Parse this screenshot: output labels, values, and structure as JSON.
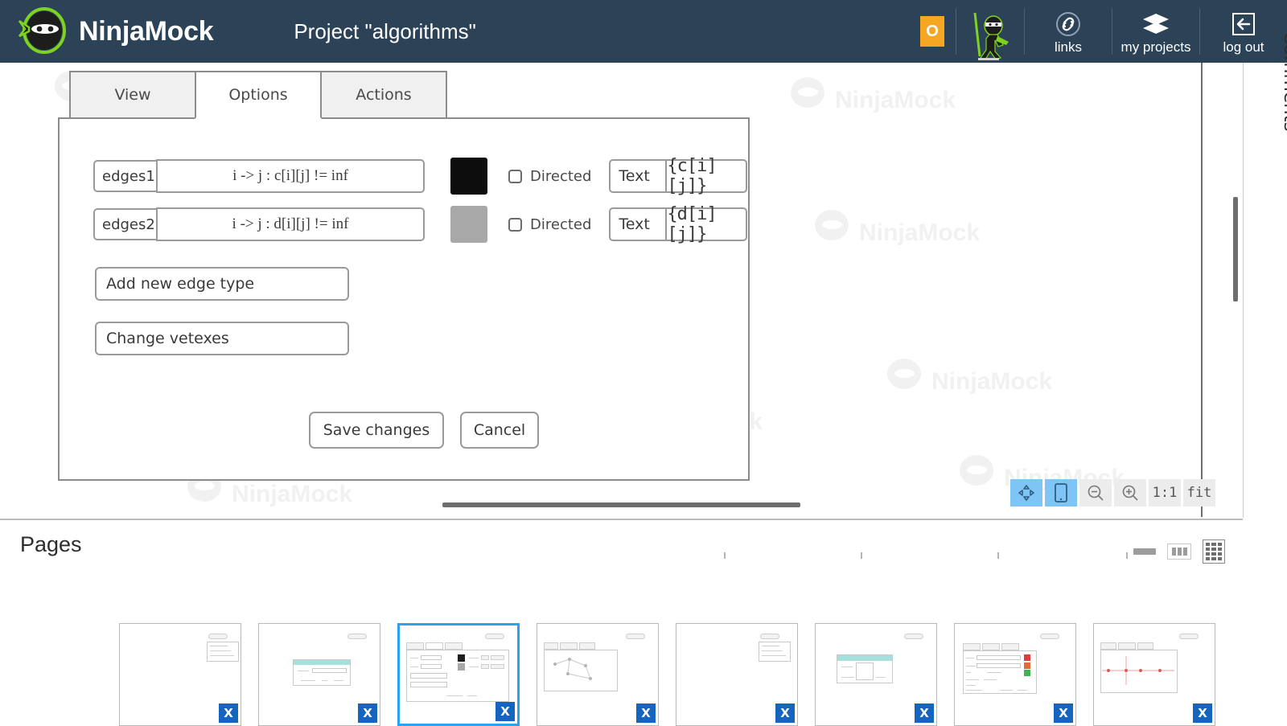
{
  "header": {
    "brand": "NinjaMock",
    "project_title": "Project \"algorithms\"",
    "badge_letter": "O",
    "items": [
      {
        "label": "links",
        "icon": "link-icon"
      },
      {
        "label": "my projects",
        "icon": "layers-icon"
      },
      {
        "label": "log out",
        "icon": "logout-arrow-icon"
      }
    ]
  },
  "canvas": {
    "tabs": [
      {
        "label": "View",
        "active": false
      },
      {
        "label": "Options",
        "active": true
      },
      {
        "label": "Actions",
        "active": false
      }
    ],
    "edge_rows": [
      {
        "name": "edges1",
        "expression": "i -> j : c[i][j] != inf",
        "color": "#0d0d0d",
        "directed_label": "Directed",
        "directed_checked": false,
        "text_type": "Text",
        "text_value": "{c[i][j]}"
      },
      {
        "name": "edges2",
        "expression": "i -> j : d[i][j] != inf",
        "color": "#a8a8a8",
        "directed_label": "Directed",
        "directed_checked": false,
        "text_type": "Text",
        "text_value": "{d[i][j]}"
      }
    ],
    "add_edge_type_label": "Add new edge type",
    "change_vertexes_label": "Change vetexes",
    "save_label": "Save changes",
    "cancel_label": "Cancel",
    "watermark_text": "NinjaMock"
  },
  "zoom_toolbar": {
    "buttons": [
      {
        "id": "pan",
        "glyph": "✥",
        "icon": "move-arrows-icon",
        "active": true
      },
      {
        "id": "device",
        "glyph": "▯",
        "icon": "device-frame-icon",
        "active": true
      },
      {
        "id": "zoom-out",
        "glyph": "⊖",
        "icon": "zoom-out-icon",
        "active": false
      },
      {
        "id": "zoom-in",
        "glyph": "⊕",
        "icon": "zoom-in-icon",
        "active": false
      },
      {
        "id": "actual-size",
        "glyph": "1:1",
        "icon": "one-to-one-icon",
        "active": false
      },
      {
        "id": "fit",
        "glyph": "fit",
        "icon": "fit-icon",
        "active": false
      }
    ]
  },
  "comments": {
    "label": "Comments"
  },
  "pages": {
    "title": "Pages",
    "view_modes": [
      {
        "id": "single",
        "icon": "single-view-icon"
      },
      {
        "id": "row",
        "icon": "row-view-icon"
      },
      {
        "id": "grid",
        "icon": "grid-view-icon",
        "active": true
      }
    ],
    "thumbnails": [
      {
        "index": 1,
        "selected": false,
        "badge": "X",
        "kind": "legend-only"
      },
      {
        "index": 2,
        "selected": false,
        "badge": "X",
        "kind": "teal-dialog"
      },
      {
        "index": 3,
        "selected": true,
        "badge": "X",
        "kind": "options-dialog"
      },
      {
        "index": 4,
        "selected": false,
        "badge": "X",
        "kind": "graph-canvas"
      },
      {
        "index": 5,
        "selected": false,
        "badge": "X",
        "kind": "legend-only"
      },
      {
        "index": 6,
        "selected": false,
        "badge": "X",
        "kind": "teal-form"
      },
      {
        "index": 7,
        "selected": false,
        "badge": "X",
        "kind": "status-dialog"
      },
      {
        "index": 8,
        "selected": false,
        "badge": "X",
        "kind": "timeline-canvas"
      }
    ]
  }
}
